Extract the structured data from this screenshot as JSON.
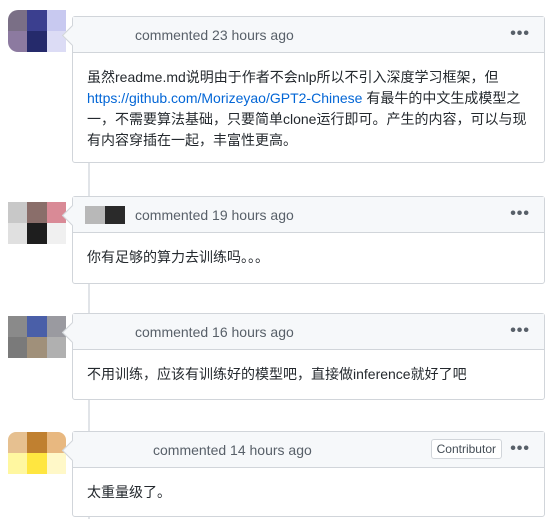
{
  "comments": [
    {
      "header": "commented 23 hours ago",
      "body_line1": "虽然readme.md说明由于作者不会nlp所以不引入深度学习框架，但",
      "link": "https://github.com/Morizeyao/GPT2-Chinese",
      "body_after_link": " 有最牛的中文生成模型之一，不需要算法基础，只要简单clone运行即可。产生的内容，可以与现有内容穿插在一起，丰富性更高。",
      "more": "•••"
    },
    {
      "header": "commented 19 hours ago",
      "body": "你有足够的算力去训练吗。。。",
      "more": "•••"
    },
    {
      "header": "commented 16 hours ago",
      "body": "不用训练，应该有训练好的模型吧，直接做inference就好了吧",
      "more": "•••"
    },
    {
      "header": "commented 14 hours ago",
      "badge": "Contributor",
      "body": "太重量级了。",
      "more": "•••"
    }
  ]
}
